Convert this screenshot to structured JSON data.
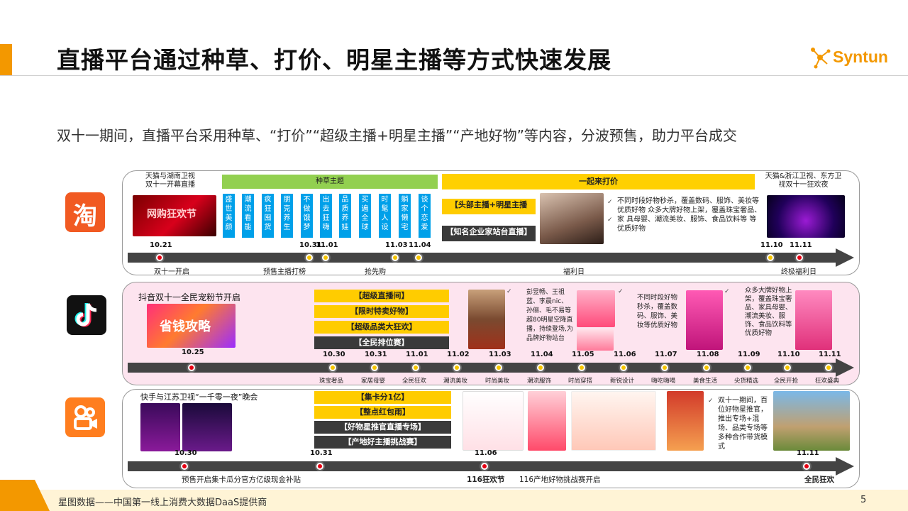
{
  "header": {
    "title": "直播平台通过种草、打价、明星主播等方式快速发展",
    "logo_text": "Syntun"
  },
  "subtitle": "双十一期间，直播平台采用种草、“打价”“超级主播+明星主播”“产地好物”等内容，分波预售，助力平台成交",
  "taobao": {
    "icon": "淘",
    "top_left": "天猫与湖南卫视\n双十一开幕直播",
    "green_header": "种草主题",
    "yellow_header": "一起来打价",
    "top_right": "天猫&浙江卫视、东方卫\n视双十一狂欢夜",
    "grass_items": [
      "盛世美颜",
      "潮流看能",
      "疯狂囤货",
      "朋克养生",
      "不做饿梦",
      "出去狂嗨",
      "品质养娃",
      "买遍全球",
      "时髦人设",
      "躺家懒宅",
      "谈个恋爱"
    ],
    "box1": "【头部主播+明星主播",
    "box2": "【知名企业家站台直播】",
    "desc": "不同时段好物秒杀，覆盖数码、服饰、美妆等优质好物 众多大牌好物上架，覆盖珠宝奢品、家 具母婴、潮流美妆、服饰、食品饮料等 等优质好物",
    "dates": [
      "10.21",
      "10.31",
      "11.01",
      "11.03",
      "11.04",
      "11.10",
      "11.11"
    ],
    "labels": [
      "双十一开启",
      "预售主播打榜",
      "抢先购",
      "福利日",
      "终极福利日"
    ]
  },
  "douyin": {
    "top_left": "抖音双十一全民宠粉节开启",
    "boxes": [
      "【超级直播间】",
      "【限时特卖好物】",
      "【超级品类大狂欢】",
      "【全民排位赛】"
    ],
    "desc1": "彭昱畅、王祖蓝、李晨nic、孙俪、毛不易等超80明星空降直播，持续登场,为品牌好物站台",
    "desc2": "不同时段好物秒杀，覆盖数码、服饰、美妆等优质好物",
    "desc3": "众多大牌好物上架，覆盖珠宝奢品、家具母婴、潮流美妆、服饰、食品饮料等优质好物",
    "dates": [
      "10.25",
      "10.30",
      "10.31",
      "11.01",
      "11.02",
      "11.03",
      "11.04",
      "11.05",
      "11.06",
      "11.07",
      "11.08",
      "11.09",
      "11.10",
      "11.11"
    ],
    "labels": [
      "珠宝奢品",
      "家居母婴",
      "全民狂欢",
      "潮流美妆",
      "时尚美妆",
      "潮流服饰",
      "时尚穿搭",
      "新锐设计",
      "嗨吃嗨喝",
      "美食生活",
      "尖货精选",
      "全民开抢",
      "狂欢盛典"
    ]
  },
  "kuaishou": {
    "top_left": "快手与江苏卫视“一千零一夜”晚会",
    "boxes": [
      "【集卡分1亿】",
      "【整点红包雨】",
      "【好物星推官直播专场】",
      "【产地好主播挑战赛】"
    ],
    "desc": "双十一期间，百位好物星推官，推出专场+混场、品类专场等多种合作带货模式",
    "dates": [
      "10.30",
      "10.31",
      "11.06",
      "11.11"
    ],
    "labels": [
      "预售开启集卡瓜分官方亿级现金补贴",
      "116狂欢节",
      "116产地好物挑战赛开启",
      "全民狂欢"
    ]
  },
  "footer": {
    "text": "星图数据——中国第一线上消费大数据DaaS提供商",
    "page": "5"
  }
}
